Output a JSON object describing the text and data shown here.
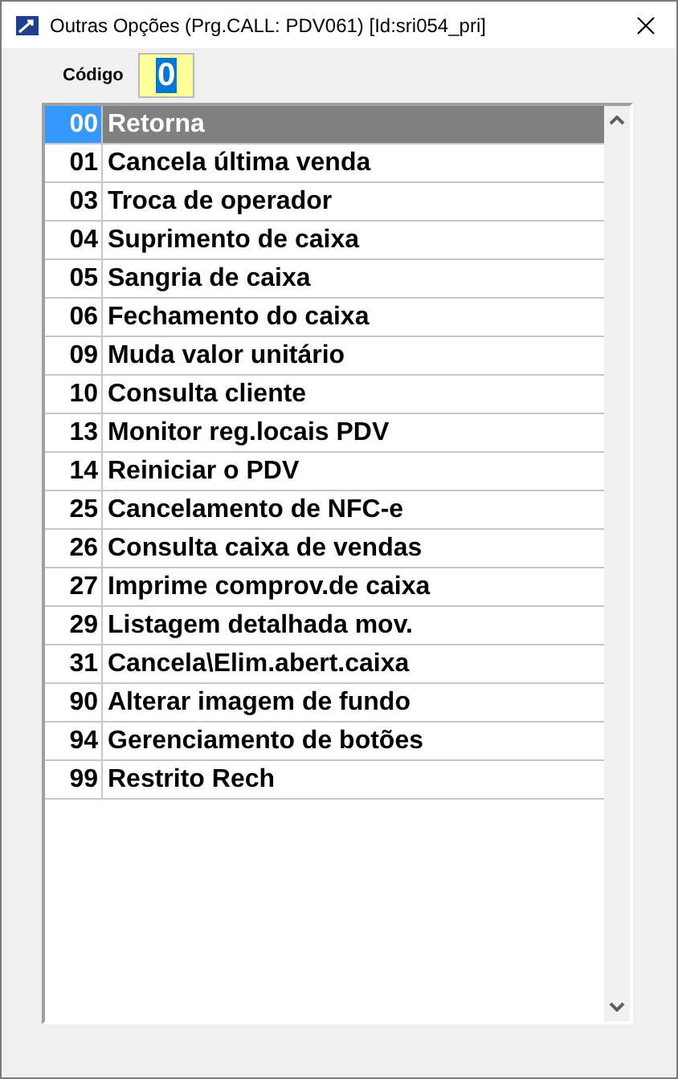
{
  "window": {
    "title": "Outras Opções (Prg.CALL: PDV061) [Id:sri054_pri]"
  },
  "code_field": {
    "label": "Código",
    "value": "0"
  },
  "options": [
    {
      "code": "00",
      "label": "Retorna",
      "selected": true
    },
    {
      "code": "01",
      "label": "Cancela última venda",
      "selected": false
    },
    {
      "code": "03",
      "label": "Troca de operador",
      "selected": false
    },
    {
      "code": "04",
      "label": "Suprimento de caixa",
      "selected": false
    },
    {
      "code": "05",
      "label": "Sangria de caixa",
      "selected": false
    },
    {
      "code": "06",
      "label": "Fechamento do caixa",
      "selected": false
    },
    {
      "code": "09",
      "label": "Muda valor unitário",
      "selected": false
    },
    {
      "code": "10",
      "label": "Consulta cliente",
      "selected": false
    },
    {
      "code": "13",
      "label": "Monitor reg.locais PDV",
      "selected": false
    },
    {
      "code": "14",
      "label": "Reiniciar o PDV",
      "selected": false
    },
    {
      "code": "25",
      "label": "Cancelamento de NFC-e",
      "selected": false
    },
    {
      "code": "26",
      "label": "Consulta caixa de vendas",
      "selected": false
    },
    {
      "code": "27",
      "label": "Imprime comprov.de caixa",
      "selected": false
    },
    {
      "code": "29",
      "label": "Listagem detalhada mov.",
      "selected": false
    },
    {
      "code": "31",
      "label": "Cancela\\Elim.abert.caixa",
      "selected": false
    },
    {
      "code": "90",
      "label": "Alterar imagem de fundo",
      "selected": false
    },
    {
      "code": "94",
      "label": "Gerenciamento de botões",
      "selected": false
    },
    {
      "code": "99",
      "label": "Restrito Rech",
      "selected": false
    }
  ]
}
